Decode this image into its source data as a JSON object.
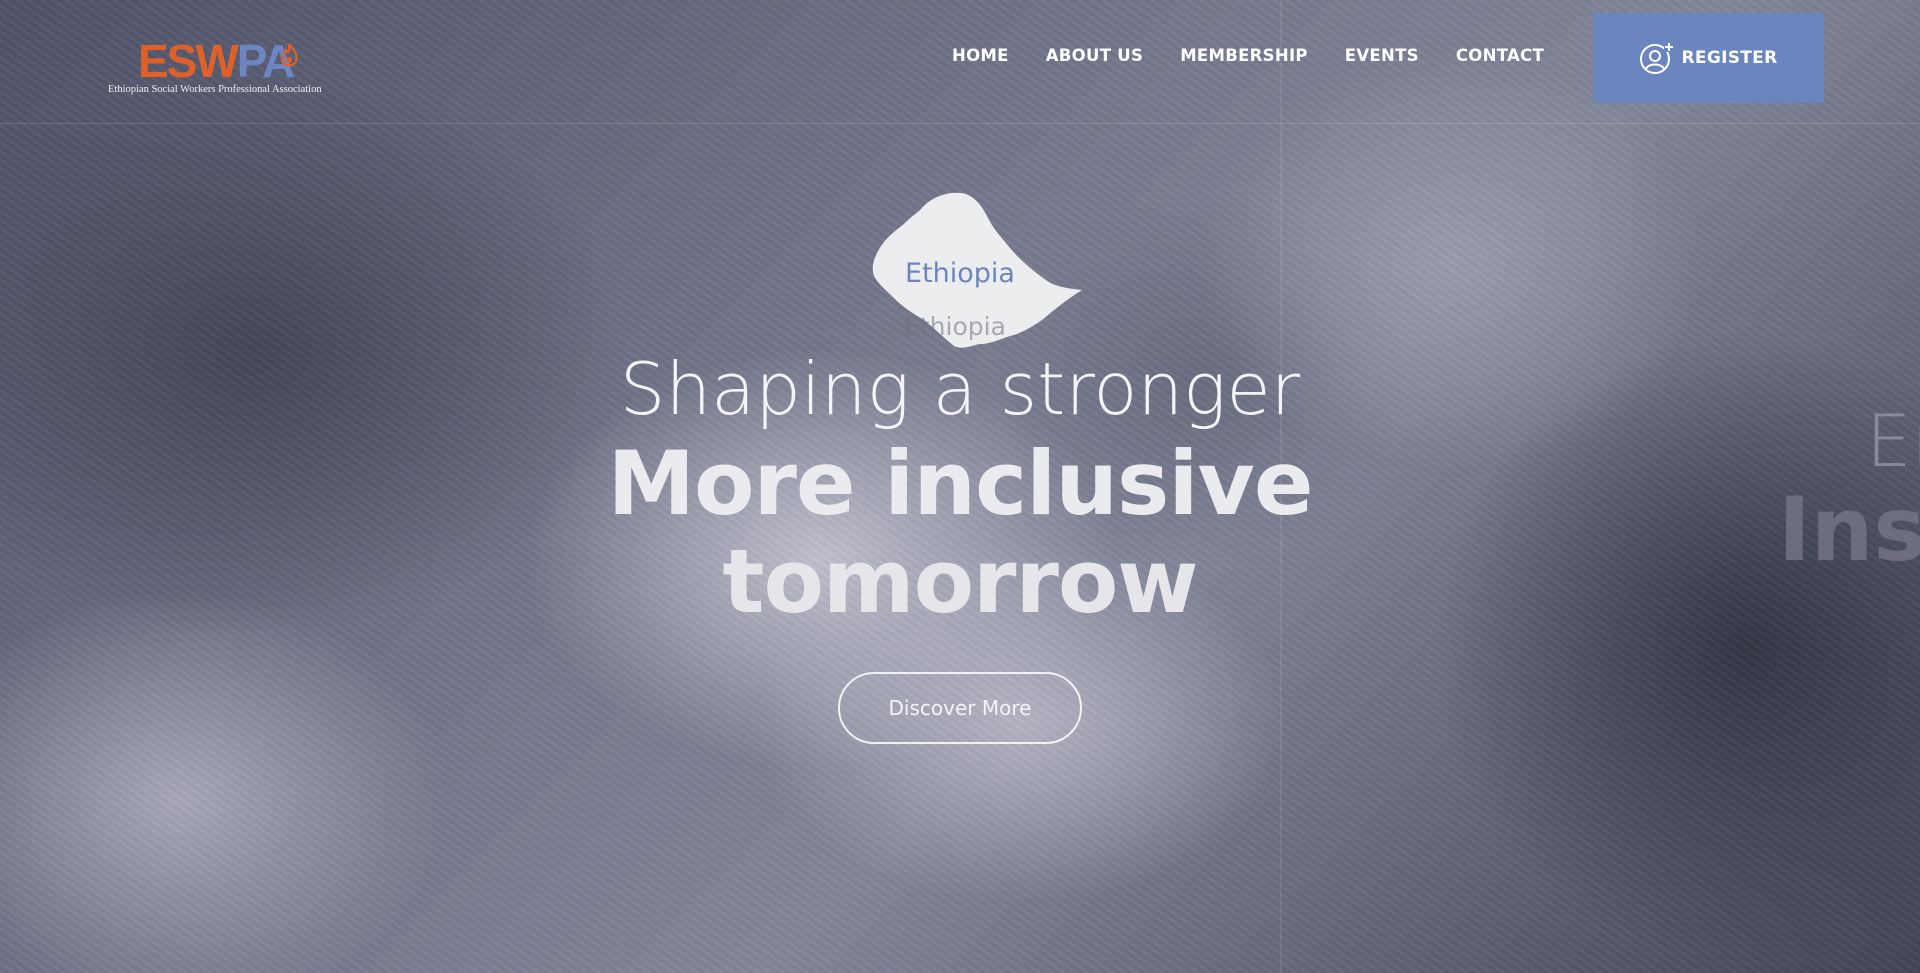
{
  "logo": {
    "mark_part1": "ESW",
    "mark_part2": "PA",
    "tagline": "Ethiopian Social Workers Professional Association",
    "colors": {
      "orange": "#e0602a",
      "blue": "#6b86c1"
    }
  },
  "nav": {
    "items": [
      {
        "label": "HOME"
      },
      {
        "label": "ABOUT US"
      },
      {
        "label": "MEMBERSHIP"
      },
      {
        "label": "EVENTS"
      },
      {
        "label": "CONTACT"
      }
    ]
  },
  "register": {
    "label": "REGISTER",
    "icon": "add-user-icon",
    "color": "#6b86bf"
  },
  "hero": {
    "map_label": "Ethiopia",
    "map_label_shadow": "Ethiopia",
    "line1": "Shaping a stronger",
    "line2": "More inclusive",
    "line3": "tomorrow",
    "cta_label": "Discover More"
  },
  "next_slide_peek": {
    "line1": "Em",
    "line2": "Ins"
  }
}
